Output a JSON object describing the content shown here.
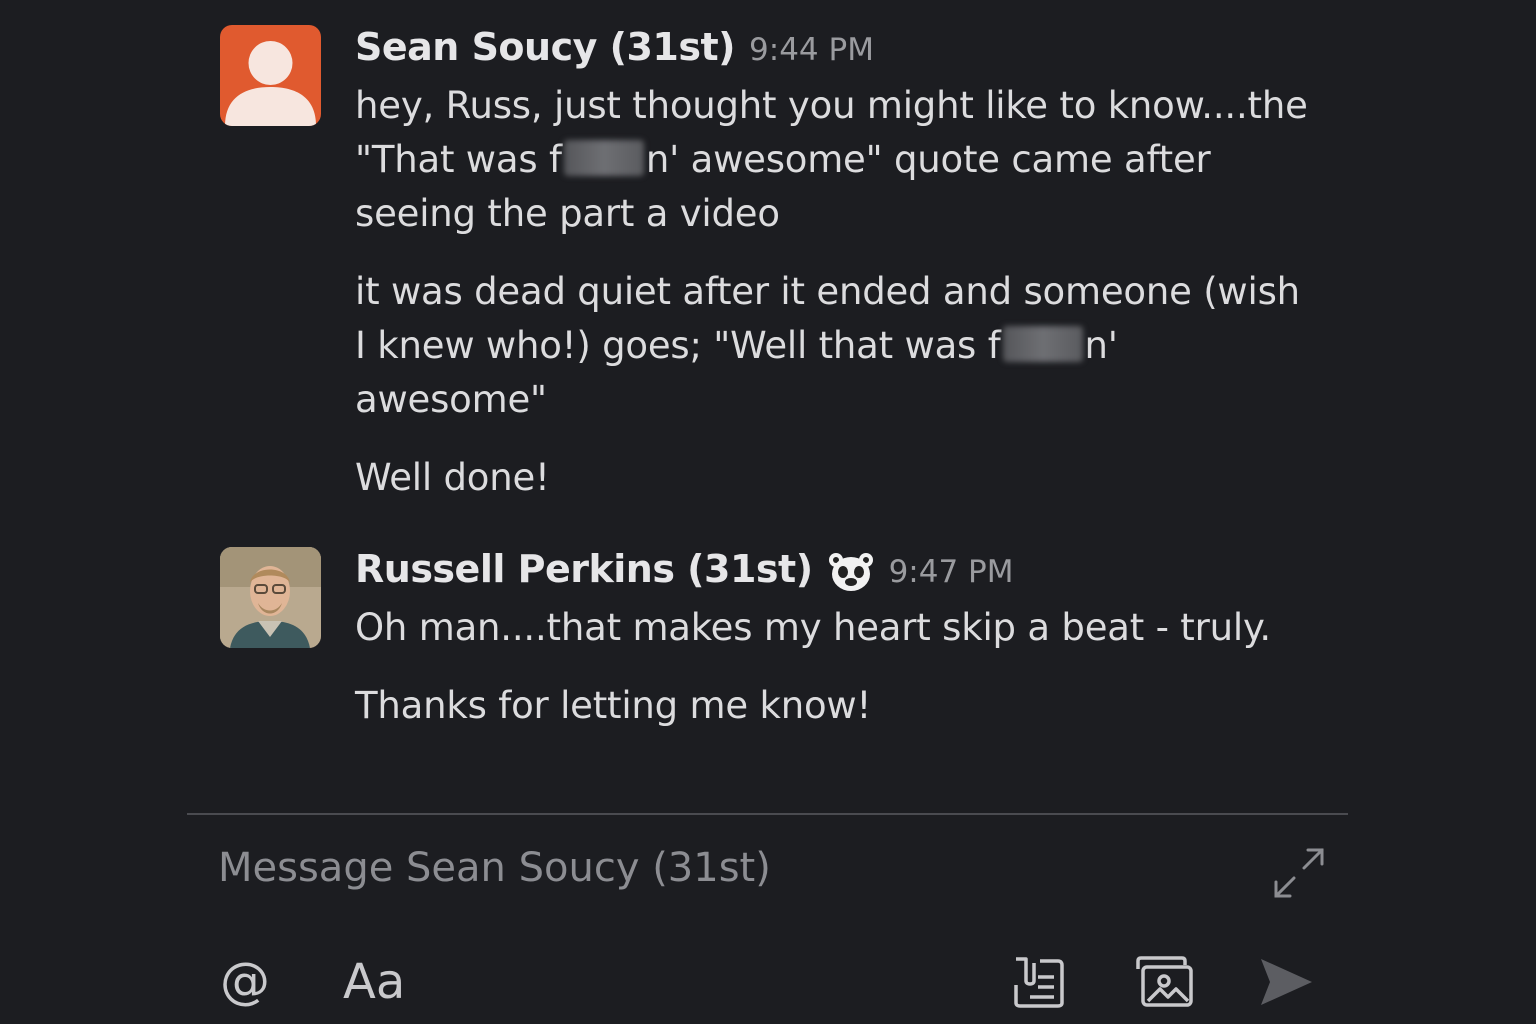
{
  "messages": [
    {
      "author": "Sean Soucy (31st)",
      "time": "9:44 PM",
      "avatar": "default-user-icon",
      "paragraphs": [
        {
          "parts": [
            "hey, Russ, just thought you might like to know....the \"That was f",
            "n' awesome\" quote came after seeing the part a video"
          ]
        },
        {
          "parts": [
            "it was dead quiet after it ended and someone (wish I knew who!) goes; \"Well that was f",
            "n' awesome\""
          ]
        },
        {
          "parts": [
            "Well done!"
          ]
        }
      ]
    },
    {
      "author": "Russell Perkins (31st)",
      "time": "9:47 PM",
      "avatar": "profile-photo",
      "status_emoji": "bear-emoji",
      "paragraphs": [
        {
          "parts": [
            "Oh man....that makes my heart skip a beat - truly."
          ]
        },
        {
          "parts": [
            "Thanks for letting me know!"
          ]
        }
      ]
    }
  ],
  "composer": {
    "placeholder": "Message Sean Soucy (31st)",
    "at_label": "@",
    "format_label": "Aa",
    "icons": [
      "expand-icon",
      "shortcuts-icon",
      "image-icon",
      "send-icon"
    ]
  },
  "colors": {
    "background": "#1c1d21",
    "default_avatar": "#e05a2f",
    "timestamp": "#9a9b9f"
  }
}
